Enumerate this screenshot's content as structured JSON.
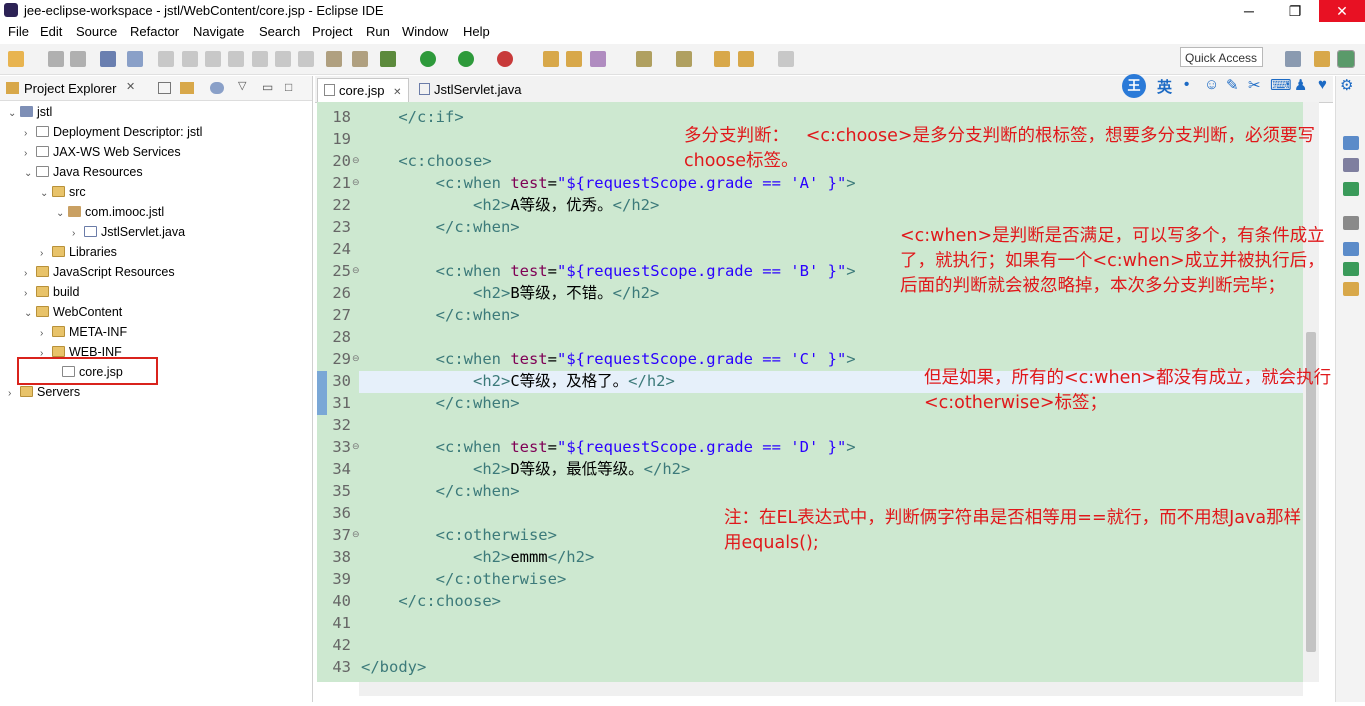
{
  "window": {
    "title": "jee-eclipse-workspace - jstl/WebContent/core.jsp - Eclipse IDE",
    "min": "─",
    "max": "❐",
    "close": "✕"
  },
  "menu": [
    "File",
    "Edit",
    "Source",
    "Refactor",
    "Navigate",
    "Search",
    "Project",
    "Run",
    "Window",
    "Help"
  ],
  "toolbar": {
    "quick_access": "Quick Access"
  },
  "explorer": {
    "title": "Project Explorer",
    "close": "✕",
    "tree": [
      {
        "label": "jstl",
        "arrow": "⌄",
        "icon": "proj"
      },
      {
        "label": "Deployment Descriptor: jstl",
        "arrow": "›",
        "icon": "fileicon"
      },
      {
        "label": "JAX-WS Web Services",
        "arrow": "›",
        "icon": "fileicon"
      },
      {
        "label": "Java Resources",
        "arrow": "⌄",
        "icon": "fileicon"
      },
      {
        "label": "src",
        "arrow": "⌄",
        "icon": "fold"
      },
      {
        "label": "com.imooc.jstl",
        "arrow": "⌄",
        "icon": "pkg"
      },
      {
        "label": "JstlServlet.java",
        "arrow": "›",
        "icon": "jfile"
      },
      {
        "label": "Libraries",
        "arrow": "›",
        "icon": "fold"
      },
      {
        "label": "JavaScript Resources",
        "arrow": "›",
        "icon": "fold"
      },
      {
        "label": "build",
        "arrow": "›",
        "icon": "fold"
      },
      {
        "label": "WebContent",
        "arrow": "⌄",
        "icon": "fold"
      },
      {
        "label": "META-INF",
        "arrow": "›",
        "icon": "fold"
      },
      {
        "label": "WEB-INF",
        "arrow": "›",
        "icon": "fold"
      },
      {
        "label": "core.jsp",
        "arrow": "",
        "icon": "fileicon"
      },
      {
        "label": "Servers",
        "arrow": "›",
        "icon": "fold"
      }
    ]
  },
  "editor": {
    "tabs": [
      {
        "label": "core.jsp",
        "close": "✕"
      },
      {
        "label": "JstlServlet.java"
      }
    ],
    "lines": [
      {
        "n": "18",
        "parts": [
          {
            "t": "    </c:if>",
            "c": "tag"
          }
        ]
      },
      {
        "n": "19",
        "parts": []
      },
      {
        "n": "20",
        "fold": "⊖",
        "parts": [
          {
            "t": "    <c:choose>",
            "c": "tag"
          }
        ]
      },
      {
        "n": "21",
        "fold": "⊖",
        "parts": [
          {
            "t": "        <c:when ",
            "c": "tag"
          },
          {
            "t": "test",
            "c": "attr"
          },
          {
            "t": "=",
            "c": "txt"
          },
          {
            "t": "\"${requestScope.grade == 'A' }\"",
            "c": "str"
          },
          {
            "t": ">",
            "c": "tag"
          }
        ]
      },
      {
        "n": "22",
        "parts": [
          {
            "t": "            <h2>",
            "c": "tag"
          },
          {
            "t": "A等级，优秀。",
            "c": "txt"
          },
          {
            "t": "</h2>",
            "c": "tag"
          }
        ]
      },
      {
        "n": "23",
        "parts": [
          {
            "t": "        </c:when>",
            "c": "tag"
          }
        ]
      },
      {
        "n": "24",
        "parts": []
      },
      {
        "n": "25",
        "fold": "⊖",
        "parts": [
          {
            "t": "        <c:when ",
            "c": "tag"
          },
          {
            "t": "test",
            "c": "attr"
          },
          {
            "t": "=",
            "c": "txt"
          },
          {
            "t": "\"${requestScope.grade == 'B' }\"",
            "c": "str"
          },
          {
            "t": ">",
            "c": "tag"
          }
        ]
      },
      {
        "n": "26",
        "parts": [
          {
            "t": "            <h2>",
            "c": "tag"
          },
          {
            "t": "B等级，不错。",
            "c": "txt"
          },
          {
            "t": "</h2>",
            "c": "tag"
          }
        ]
      },
      {
        "n": "27",
        "parts": [
          {
            "t": "        </c:when>",
            "c": "tag"
          }
        ]
      },
      {
        "n": "28",
        "parts": []
      },
      {
        "n": "29",
        "fold": "⊖",
        "parts": [
          {
            "t": "        <c:when ",
            "c": "tag"
          },
          {
            "t": "test",
            "c": "attr"
          },
          {
            "t": "=",
            "c": "txt"
          },
          {
            "t": "\"${requestScope.grade == 'C' }\"",
            "c": "str"
          },
          {
            "t": ">",
            "c": "tag"
          }
        ]
      },
      {
        "n": "30",
        "parts": [
          {
            "t": "            <h2>",
            "c": "tag"
          },
          {
            "t": "C等级，及格了。",
            "c": "txt"
          },
          {
            "t": "</h2>",
            "c": "tag"
          }
        ]
      },
      {
        "n": "31",
        "parts": [
          {
            "t": "        </c:when>",
            "c": "tag"
          }
        ]
      },
      {
        "n": "32",
        "parts": []
      },
      {
        "n": "33",
        "fold": "⊖",
        "parts": [
          {
            "t": "        <c:when ",
            "c": "tag"
          },
          {
            "t": "test",
            "c": "attr"
          },
          {
            "t": "=",
            "c": "txt"
          },
          {
            "t": "\"${requestScope.grade == 'D' }\"",
            "c": "str"
          },
          {
            "t": ">",
            "c": "tag"
          }
        ]
      },
      {
        "n": "34",
        "parts": [
          {
            "t": "            <h2>",
            "c": "tag"
          },
          {
            "t": "D等级，最低等级。",
            "c": "txt"
          },
          {
            "t": "</h2>",
            "c": "tag"
          }
        ]
      },
      {
        "n": "35",
        "parts": [
          {
            "t": "        </c:when>",
            "c": "tag"
          }
        ]
      },
      {
        "n": "36",
        "parts": []
      },
      {
        "n": "37",
        "fold": "⊖",
        "parts": [
          {
            "t": "        <c:otherwise>",
            "c": "tag"
          }
        ]
      },
      {
        "n": "38",
        "parts": [
          {
            "t": "            <h2>",
            "c": "tag"
          },
          {
            "t": "emmm",
            "c": "txt"
          },
          {
            "t": "</h2>",
            "c": "tag"
          }
        ]
      },
      {
        "n": "39",
        "parts": [
          {
            "t": "        </c:otherwise>",
            "c": "tag"
          }
        ]
      },
      {
        "n": "40",
        "parts": [
          {
            "t": "    </c:choose>",
            "c": "tag"
          }
        ]
      },
      {
        "n": "41",
        "parts": []
      },
      {
        "n": "42",
        "parts": []
      },
      {
        "n": "43",
        "parts": [
          {
            "t": "</body>",
            "c": "tag"
          }
        ]
      }
    ]
  },
  "annotations": {
    "a1": "多分支判断：   <c:choose>是多分支判断的根标签，想要多分支判断，必须要写\nchoose标签。",
    "a2": "<c:when>是判断是否满足，可以写多个，有条件成立\n了，就执行；如果有一个<c:when>成立并被执行后，\n后面的判断就会被忽略掉，本次多分支判断完毕；",
    "a3": "但是如果，所有的<c:when>都没有成立，就会执行\n<c:otherwise>标签；",
    "a4": "注：在EL表达式中，判断俩字符串是否相等用==就行，而不用想Java那样\n用equals();"
  },
  "ime": {
    "logo": "王",
    "lang": "英"
  },
  "colors": {
    "editor_bg": "#cde8d0",
    "annotation": "#e0181b",
    "highlight_box": "#d9231c"
  }
}
